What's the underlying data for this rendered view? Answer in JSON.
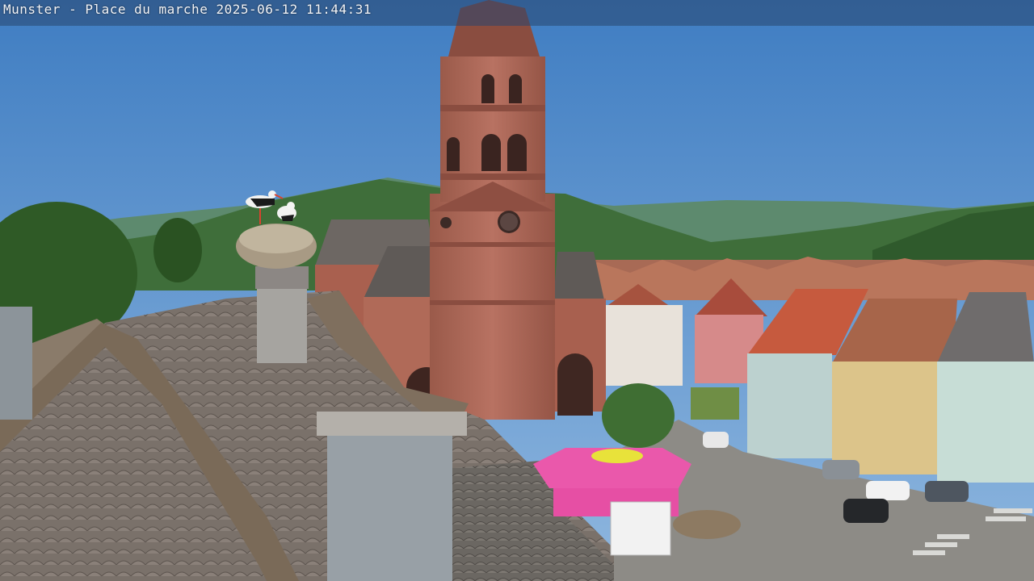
{
  "overlay": {
    "location": "Munster - Place du marche",
    "date": "2025-06-12",
    "time": "11:44:31"
  },
  "scene": {
    "subjects": [
      "storks-on-nest",
      "church-tower",
      "tiled-roof",
      "market-square",
      "pink-pavilion",
      "houses",
      "mountains",
      "trees"
    ],
    "colors": {
      "sky": "#4f88c6",
      "sandstone": "#b06a58",
      "roof": "#6e6a66",
      "pavilion": "#e64fa4",
      "forest": "#3f6e3a"
    }
  }
}
